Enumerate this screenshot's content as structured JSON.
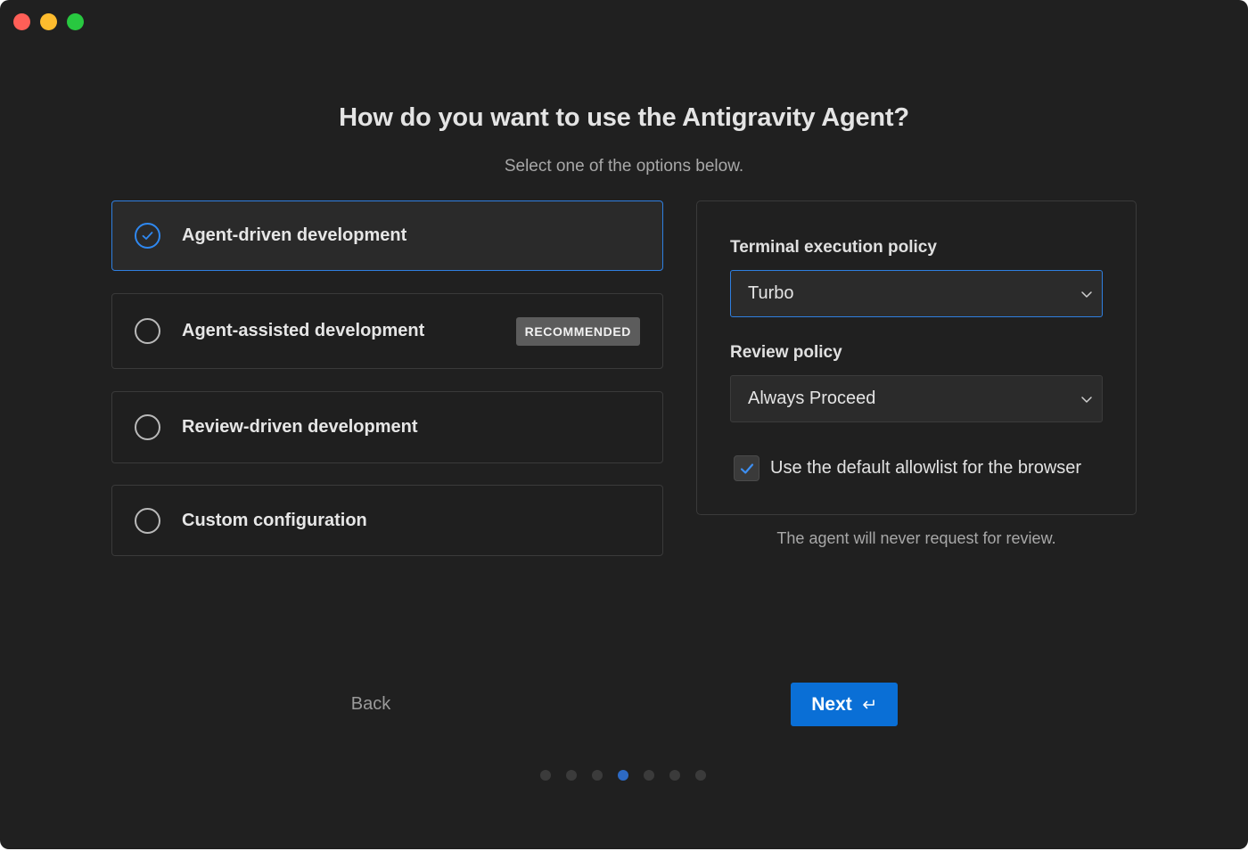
{
  "window": {
    "traffic_lights": [
      "close",
      "minimize",
      "zoom"
    ]
  },
  "header": {
    "title": "How do you want to use the Antigravity Agent?",
    "subtitle": "Select one of the options below."
  },
  "options": [
    {
      "label": "Agent-driven development",
      "selected": true
    },
    {
      "label": "Agent-assisted development",
      "badge": "RECOMMENDED",
      "selected": false
    },
    {
      "label": "Review-driven development",
      "selected": false
    },
    {
      "label": "Custom configuration",
      "selected": false
    }
  ],
  "settings": {
    "terminal_label": "Terminal execution policy",
    "terminal_value": "Turbo",
    "review_label": "Review policy",
    "review_value": "Always Proceed",
    "allowlist_label": "Use the default allowlist for the browser",
    "allowlist_checked": true,
    "hint": "The agent will never request for review."
  },
  "footer": {
    "back_label": "Back",
    "next_label": "Next",
    "step_count": 7,
    "current_step": 4
  },
  "colors": {
    "accent": "#2f7fe0",
    "primary_button": "#0a6fd6",
    "background": "#202020"
  }
}
